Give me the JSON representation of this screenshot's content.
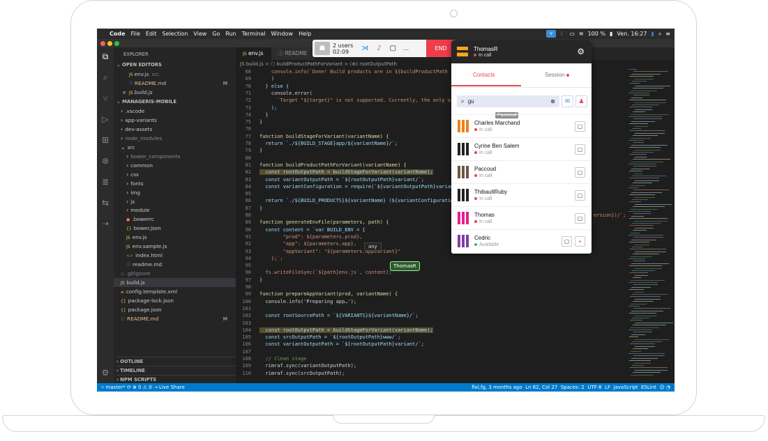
{
  "menubar": {
    "apple": "",
    "app": "Code",
    "items": [
      "File",
      "Edit",
      "Selection",
      "View",
      "Go",
      "Run",
      "Terminal",
      "Window",
      "Help"
    ],
    "battery": "100 %",
    "clock": "Ven. 16:27"
  },
  "callbar": {
    "users": "2 users",
    "time": "02:09",
    "end_label": "END"
  },
  "activity_icons": [
    "files-icon",
    "search-icon",
    "source-control-icon",
    "run-icon",
    "extensions-icon",
    "timeline-icon",
    "docker-icon",
    "remote-icon",
    "liveshare-icon"
  ],
  "sidebar": {
    "explorer": "EXPLORER",
    "open_editors": "OPEN EDITORS",
    "open_files": [
      {
        "name": "env.js",
        "hint": "src",
        "mark": ""
      },
      {
        "name": "README.md",
        "hint": "",
        "mark": "M"
      },
      {
        "name": "build.js",
        "hint": "",
        "mark": ""
      }
    ],
    "project": "MANAGERIS-MOBILE",
    "tree": [
      {
        "name": ".vscode",
        "kind": "folder",
        "depth": 1
      },
      {
        "name": "app-variants",
        "kind": "folder",
        "depth": 1
      },
      {
        "name": "dev-assets",
        "kind": "folder",
        "depth": 1
      },
      {
        "name": "node_modules",
        "kind": "folder",
        "depth": 1
      },
      {
        "name": "src",
        "kind": "folder-open",
        "depth": 1
      },
      {
        "name": "bower_components",
        "kind": "folder",
        "depth": 2
      },
      {
        "name": "common",
        "kind": "folder",
        "depth": 2
      },
      {
        "name": "css",
        "kind": "folder",
        "depth": 2
      },
      {
        "name": "fonts",
        "kind": "folder",
        "depth": 2
      },
      {
        "name": "img",
        "kind": "folder",
        "depth": 2
      },
      {
        "name": "js",
        "kind": "folder",
        "depth": 2
      },
      {
        "name": "module",
        "kind": "folder",
        "depth": 2
      },
      {
        "name": ".bowerrc",
        "kind": "file",
        "depth": 2
      },
      {
        "name": "bower.json",
        "kind": "file",
        "depth": 2
      },
      {
        "name": "env.js",
        "kind": "file",
        "depth": 2
      },
      {
        "name": "env.sample.js",
        "kind": "file",
        "depth": 2
      },
      {
        "name": "index.html",
        "kind": "file",
        "depth": 2
      },
      {
        "name": "readme.md",
        "kind": "file",
        "depth": 2
      },
      {
        "name": ".gitignore",
        "kind": "file",
        "depth": 1
      },
      {
        "name": "build.js",
        "kind": "file",
        "depth": 1
      },
      {
        "name": "config.template.xml",
        "kind": "file",
        "depth": 1
      },
      {
        "name": "package-lock.json",
        "kind": "file",
        "depth": 1
      },
      {
        "name": "package.json",
        "kind": "file",
        "depth": 1
      },
      {
        "name": "README.md",
        "kind": "file",
        "depth": 1
      }
    ],
    "tree_mark_readme": "M",
    "outline": "OUTLINE",
    "timeline": "TIMELINE",
    "npm": "NPM SCRIPTS"
  },
  "editor": {
    "tabs": [
      "env.js",
      "README"
    ],
    "breadcrumb": "JS build.js > ⬡ buildProductPathForVariant > (⊕) rootOutputPath",
    "lines": [
      {
        "n": "68",
        "t": "    console.info(`Done! Build products are in ${buildProductPath"
      },
      {
        "n": "69",
        "t": "    )"
      },
      {
        "n": "70",
        "t": "  } else {"
      },
      {
        "n": "71",
        "t": "    console.error("
      },
      {
        "n": "72",
        "t": "      `Target \"${target}\" is not supported. Currently, the only va"
      },
      {
        "n": "73",
        "t": "    );"
      },
      {
        "n": "74",
        "t": "  }"
      },
      {
        "n": "75",
        "t": "}"
      },
      {
        "n": "76",
        "t": ""
      },
      {
        "n": "77",
        "t": "function buildStageForVariant(variantName) {"
      },
      {
        "n": "78",
        "t": "  return `./${BUILD_STAGE}app/${variantName}/`;"
      },
      {
        "n": "79",
        "t": "}"
      },
      {
        "n": "80",
        "t": ""
      },
      {
        "n": "81",
        "t": "function buildProductPathForVariant(variantName) {"
      },
      {
        "n": "82",
        "t": "  const rootOutputPath = buildStageForVariant(variantName);"
      },
      {
        "n": "83",
        "t": "  const variantOutputPath = `${rootOutputPath}variant/`;"
      },
      {
        "n": "84",
        "t": "  const variantConfiguration = require(`${variantOutputPath}variant"
      },
      {
        "n": "85",
        "t": ""
      },
      {
        "n": "86",
        "t": "  return `./${BUILD_PRODUCTS}${variantName} (${variantConfiguration"
      },
      {
        "n": "87",
        "t": "}"
      },
      {
        "n": "88",
        "t": ""
      },
      {
        "n": "89",
        "t": "function generateEnvFile(parameters, path) {"
      },
      {
        "n": "90",
        "t": "  const content = `var BUILD_ENV = {"
      },
      {
        "n": "91",
        "t": "        \"prod\": ${parameters.prod},"
      },
      {
        "n": "92",
        "t": "        \"app\": ${parameters.app},"
      },
      {
        "n": "93",
        "t": "        \"appVariant\": \"${parameters.appVariant}\""
      },
      {
        "n": "94",
        "t": "    };`;"
      },
      {
        "n": "95",
        "t": ""
      },
      {
        "n": "96",
        "t": "  fs.writeFileSync(`${path}env.js`, content);"
      },
      {
        "n": "97",
        "t": "}"
      },
      {
        "n": "98",
        "t": ""
      },
      {
        "n": "99",
        "t": "function prepareAppVariant(prod, variantName) {"
      },
      {
        "n": "100",
        "t": "  console.info('Preparing app…');"
      },
      {
        "n": "101",
        "t": ""
      },
      {
        "n": "102",
        "t": "  const rootSourcePath = `${VARIANTS}${variantName}/`;"
      },
      {
        "n": "103",
        "t": ""
      },
      {
        "n": "104",
        "t": "  const rootOutputPath = buildStageForVariant(variantName);"
      },
      {
        "n": "105",
        "t": "  const srcOutputPath = `${rootOutputPath}www/`;"
      },
      {
        "n": "106",
        "t": "  const variantOutputPath = `${rootOutputPath}variant/`;"
      },
      {
        "n": "107",
        "t": ""
      },
      {
        "n": "108",
        "t": "  // Clean stage"
      },
      {
        "n": "109",
        "t": "  rimraf.sync(variantOutputPath);"
      },
      {
        "n": "110",
        "t": "  rimraf.sync(srcOutputPath);"
      }
    ],
    "overflow_text": "ersion})/`;",
    "type_hint": "any",
    "cursor_user": "ThomasR"
  },
  "statusbar": {
    "branch": "master*",
    "problems": "⊗ 0 ⚠ 0",
    "liveshare": "Live Share",
    "blame": "flol,fg, 3 months ago",
    "position": "Ln 82, Col 27",
    "spaces": "Spaces: 2",
    "encoding": "UTF-8",
    "eol": "LF",
    "language": "JavaScript",
    "linter": "ESLint"
  },
  "panel": {
    "user": "ThomasR",
    "user_status": "In call",
    "tab_contacts": "Contacts",
    "tab_session": "Session",
    "search_value": "gu",
    "hover_tip": "Paccoud",
    "contacts": [
      {
        "name": "Charles Marchand",
        "status": "In call",
        "color": "#e5484d"
      },
      {
        "name": "Cyrine Ben Salem",
        "status": "In call",
        "color": "#e5484d"
      },
      {
        "name": "Paccoud",
        "status": "In call",
        "color": "#e5484d"
      },
      {
        "name": "ThibaultRuby",
        "status": "In call",
        "color": "#e5484d"
      },
      {
        "name": "Thomas",
        "status": "In call",
        "color": "#e5484d"
      },
      {
        "name": "Cedric",
        "status": "Available",
        "color": "#3cb371"
      }
    ]
  },
  "colors": {
    "accent": "#007acc",
    "end": "#ef3d4a",
    "panel_accent": "#e5484d"
  }
}
